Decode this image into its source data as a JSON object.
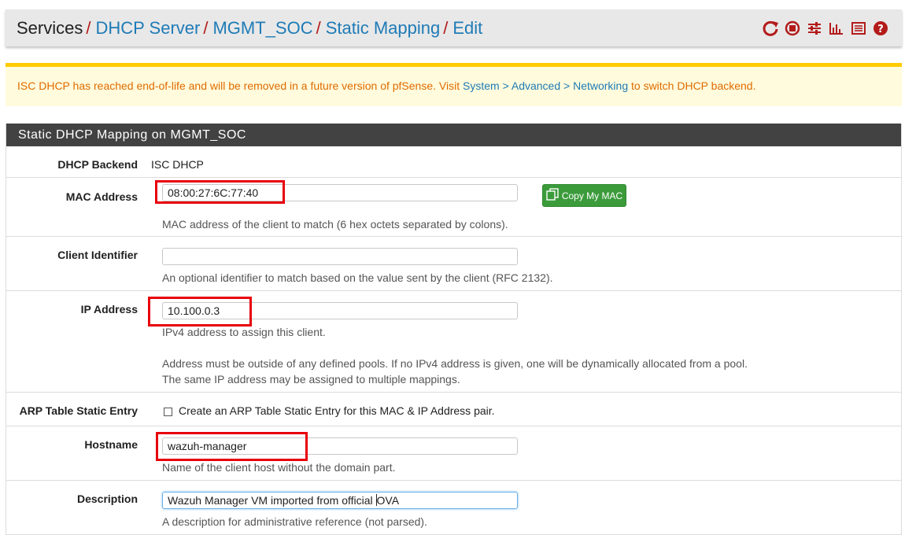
{
  "breadcrumb": {
    "items": [
      "Services",
      "DHCP Server",
      "MGMT_SOC",
      "Static Mapping",
      "Edit"
    ],
    "separator": "/"
  },
  "header_icons": [
    "reload-icon",
    "stop-icon",
    "settings-sliders-icon",
    "chart-icon",
    "log-list-icon",
    "help-icon"
  ],
  "alert": {
    "text_before": "ISC DHCP has reached end-of-life and will be removed in a future version of pfSense. Visit ",
    "link": "System > Advanced > Networking",
    "text_after": " to switch DHCP backend."
  },
  "panel": {
    "title": "Static DHCP Mapping on MGMT_SOC"
  },
  "form": {
    "dhcp_backend": {
      "label": "DHCP Backend",
      "value": "ISC DHCP"
    },
    "mac_address": {
      "label": "MAC Address",
      "value": "08:00:27:6C:77:40",
      "button": "Copy My MAC",
      "help": "MAC address of the client to match (6 hex octets separated by colons)."
    },
    "client_identifier": {
      "label": "Client Identifier",
      "value": "",
      "help": "An optional identifier to match based on the value sent by the client (RFC 2132)."
    },
    "ip_address": {
      "label": "IP Address",
      "value": "10.100.0.3",
      "help1": "IPv4 address to assign this client.",
      "help2": "Address must be outside of any defined pools. If no IPv4 address is given, one will be dynamically allocated from a pool.",
      "help3": "The same IP address may be assigned to multiple mappings."
    },
    "arp_entry": {
      "label": "ARP Table Static Entry",
      "checkbox_label": "Create an ARP Table Static Entry for this MAC & IP Address pair.",
      "checked": false
    },
    "hostname": {
      "label": "Hostname",
      "value": "wazuh-manager",
      "help": "Name of the client host without the domain part."
    },
    "description": {
      "label": "Description",
      "value_before_caret": "Wazuh Manager VM imported from official ",
      "value_after_caret": "OVA",
      "help": "A description for administrative reference (not parsed)."
    }
  },
  "colors": {
    "link": "#1e7bb6",
    "separator": "#b31b1b",
    "alert_text": "#e06b00",
    "alert_bg": "#fffbdc",
    "alert_border": "#ffcc00",
    "panel_header": "#424242",
    "button_green": "#3b9b3b",
    "highlight_red": "#e8000c"
  }
}
